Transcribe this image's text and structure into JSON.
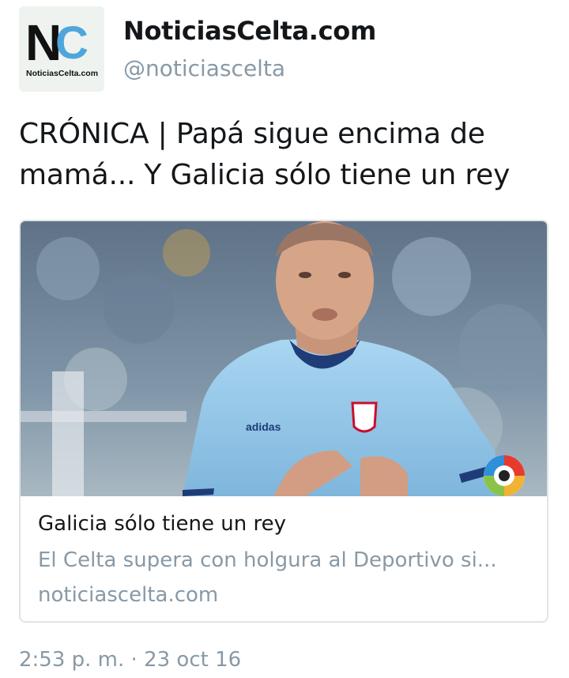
{
  "tweet": {
    "author": {
      "display_name": "NoticiasCelta.com",
      "handle": "@noticiascelta",
      "avatar": {
        "logo_letters": "NC",
        "logo_caption": "NoticiasCelta.com"
      }
    },
    "text": "CRÓNICA | Papá sigue encima de mamá... Y Galicia sólo tiene un rey",
    "card": {
      "image_icon": "football-player-photo",
      "badge_icon": "laliga-logo-icon",
      "title": "Galicia sólo tiene un rey",
      "description": "El Celta supera con holgura al Deportivo si...",
      "domain": "noticiascelta.com"
    },
    "timestamp": "2:53 p. m. · 23 oct 16"
  },
  "colors": {
    "text_primary": "#14171a",
    "text_secondary": "#8899a6",
    "card_border": "#dfe4e8",
    "celta_blue": "#8ec4e8"
  }
}
